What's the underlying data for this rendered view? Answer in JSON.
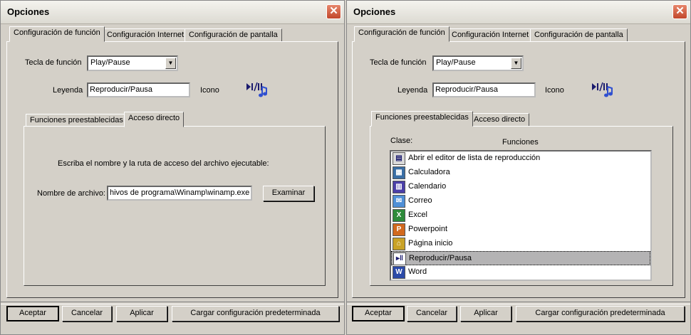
{
  "dialog": {
    "title": "Opciones",
    "close_symbol": "✕",
    "tabs": [
      "Configuración de función",
      "Configuración Internet",
      "Configuración de pantalla"
    ],
    "function_key_label": "Tecla de función",
    "function_key_value": "Play/Pause",
    "caption_label": "Leyenda",
    "caption_value": "Reproducir/Pausa",
    "icon_label": "Icono",
    "sub_tabs": [
      "Funciones preestablecidas",
      "Acceso directo"
    ],
    "buttons": {
      "accept": "Aceptar",
      "cancel": "Cancelar",
      "apply": "Aplicar",
      "load_default": "Cargar configuración predeterminada"
    }
  },
  "left_window": {
    "active_sub_tab": "Acceso directo",
    "instruction": "Escriba el nombre y la ruta de acceso del archivo ejecutable:",
    "file_name_label": "Nombre de archivo:",
    "file_name_value": "hivos de programa\\Winamp\\winamp.exe",
    "browse_button": "Examinar"
  },
  "right_window": {
    "active_sub_tab": "Funciones preestablecidas",
    "class_header": "Clase:",
    "functions_header": "Funciones",
    "functions": [
      {
        "label": "Abrir el editor de lista de reproducción",
        "icon": "playlist-editor-icon",
        "color": "#d9d9d9",
        "glyph": "▤"
      },
      {
        "label": "Calculadora",
        "icon": "calculator-icon",
        "color": "#3a6ea5",
        "glyph": "▦"
      },
      {
        "label": "Calendario",
        "icon": "calendar-icon",
        "color": "#4b3fa8",
        "glyph": "▥"
      },
      {
        "label": "Correo",
        "icon": "mail-icon",
        "color": "#4f8fd6",
        "glyph": "✉"
      },
      {
        "label": "Excel",
        "icon": "excel-icon",
        "color": "#2e8b3a",
        "glyph": "X"
      },
      {
        "label": "Powerpoint",
        "icon": "powerpoint-icon",
        "color": "#d2691e",
        "glyph": "P"
      },
      {
        "label": "Página inicio",
        "icon": "home-icon",
        "color": "#c9a227",
        "glyph": "⌂"
      },
      {
        "label": "Reproducir/Pausa",
        "icon": "play-pause-icon",
        "color": "#ffffff",
        "glyph": "▸‖"
      },
      {
        "label": "Word",
        "icon": "word-icon",
        "color": "#2b4aa8",
        "glyph": "W"
      }
    ],
    "selected_function": "Reproducir/Pausa"
  }
}
